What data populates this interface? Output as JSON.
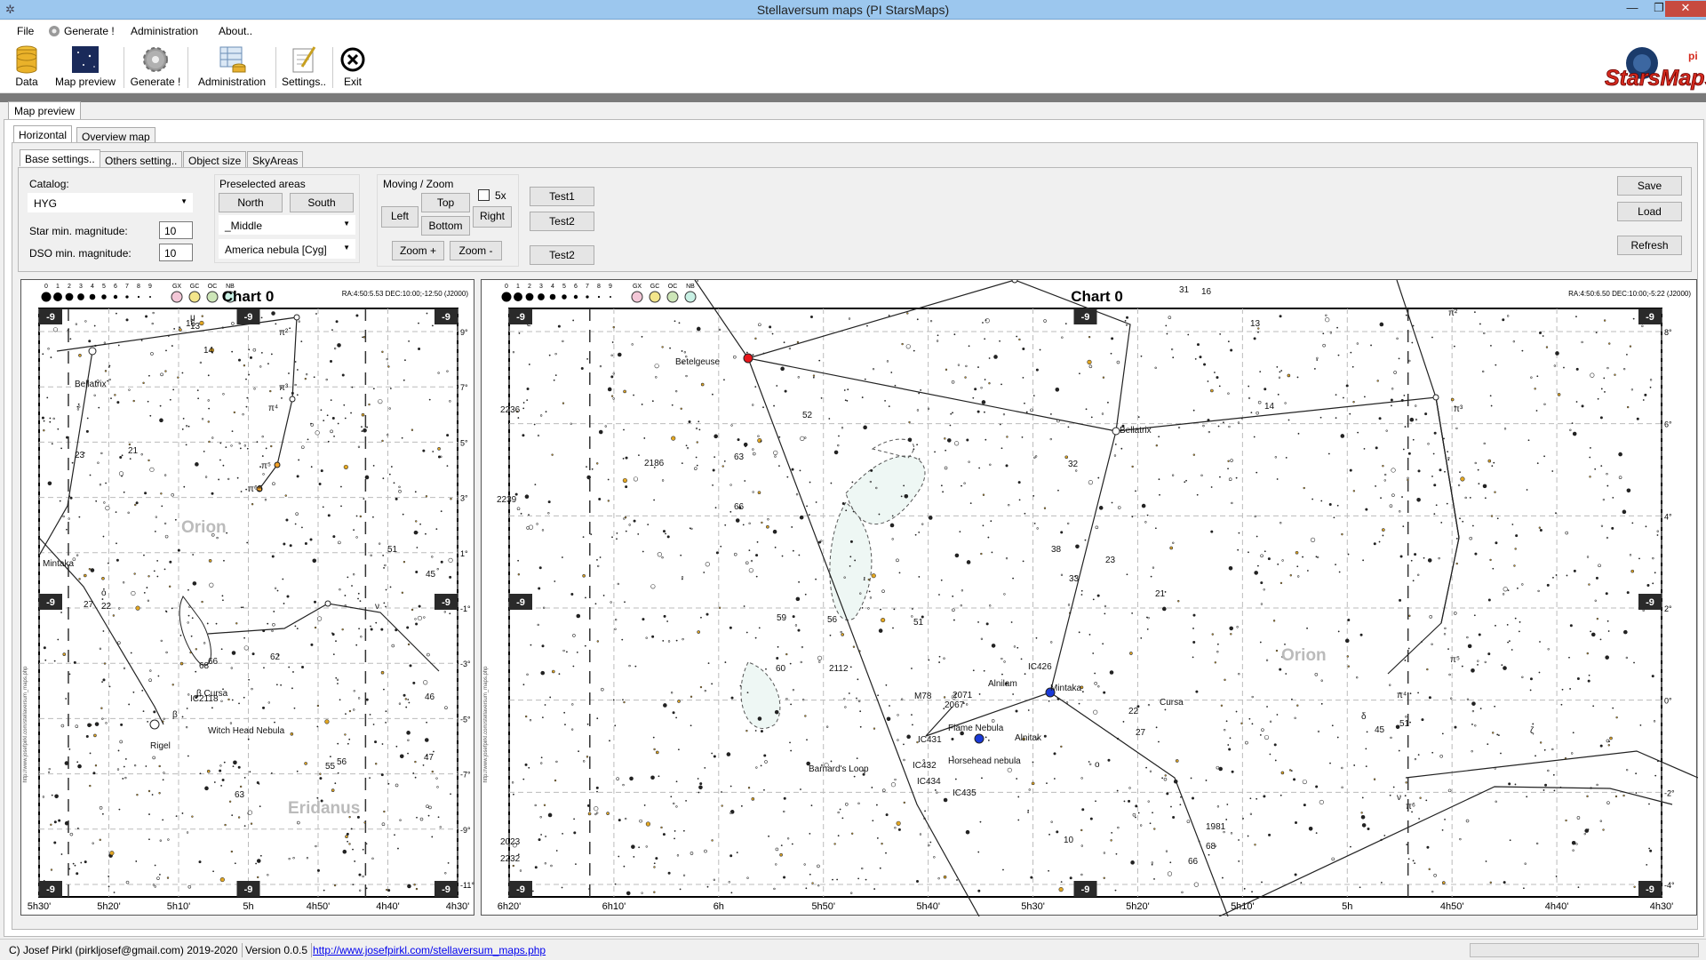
{
  "window": {
    "title": "Stellaversum maps (PI StarsMaps)",
    "min": "—",
    "max": "❐",
    "close": "✕"
  },
  "menu": [
    {
      "label": "File"
    },
    {
      "label": "Generate !"
    },
    {
      "label": "Administration"
    },
    {
      "label": "About.."
    }
  ],
  "toolbar": [
    {
      "label": "Data",
      "icon": "database-icon"
    },
    {
      "label": "Map preview",
      "icon": "map-preview-icon"
    },
    {
      "label": "Generate !",
      "icon": "gear-icon"
    },
    {
      "label": "Administration",
      "icon": "administration-icon"
    },
    {
      "label": "Settings..",
      "icon": "settings-icon"
    },
    {
      "label": "Exit",
      "icon": "exit-icon"
    }
  ],
  "logo": {
    "text": "StarsMaps",
    "superscript": "pi"
  },
  "outer_tab": "Map preview",
  "view_tabs": [
    {
      "label": "Horizontal",
      "active": true
    },
    {
      "label": "Overview map",
      "active": false
    }
  ],
  "settings_tabs": [
    {
      "label": "Base settings..",
      "active": true
    },
    {
      "label": "Others setting..",
      "active": false
    },
    {
      "label": "Object size",
      "active": false
    },
    {
      "label": "SkyAreas",
      "active": false
    }
  ],
  "settings": {
    "catalog_label": "Catalog:",
    "catalog_value": "HYG",
    "star_mag_label": "Star min. magnitude:",
    "star_mag_value": "10",
    "dso_mag_label": "DSO min. magnitude:",
    "dso_mag_value": "10",
    "preselected_title": "Preselected areas",
    "north": "North",
    "south": "South",
    "area_value": "_Middle",
    "object_value": "America nebula [Cyg]",
    "moving_title": "Moving / Zoom",
    "left": "Left",
    "top": "Top",
    "bottom": "Bottom",
    "right": "Right",
    "fivex": "5x",
    "zoom_in": "Zoom +",
    "zoom_out": "Zoom -",
    "test1": "Test1",
    "test2a": "Test2",
    "test2b": "Test2",
    "save": "Save",
    "load": "Load",
    "refresh": "Refresh"
  },
  "charts": [
    {
      "title": "Chart 0",
      "info": "RA:4:50:5.53  DEC:10:00;-12:50  (J2000)",
      "corner": "-9",
      "mag_scale": [
        "0",
        "1",
        "2",
        "3",
        "4",
        "5",
        "6",
        "7",
        "8",
        "9"
      ],
      "legend": [
        "GX",
        "GC",
        "OC",
        "NB"
      ],
      "ra_ticks": [
        "5h30'",
        "5h20'",
        "5h10'",
        "5h",
        "4h50'",
        "4h40'",
        "4h30'"
      ],
      "dec_ticks": [
        "9°",
        "7°",
        "5°",
        "3°",
        "1°",
        "-1°",
        "-3°",
        "-5°",
        "-7°",
        "-9°",
        "-11°"
      ],
      "constellations": [
        "Orion",
        "Eridanus"
      ],
      "labels": [
        "Bellatrix",
        "Mintaka",
        "Rigel",
        "β Cursa",
        "IC2118",
        "Witch Head Nebula",
        "16",
        "13",
        "14",
        "21",
        "23",
        "27",
        "22",
        "45",
        "51",
        "56",
        "55",
        "63",
        "66",
        "62",
        "46",
        "47",
        "68",
        "π²",
        "π³",
        "π⁴",
        "π⁵",
        "π⁶",
        "5",
        "ν",
        "ο",
        "μ",
        "β"
      ],
      "vertical_text": "http://www.josefpirkl.com/stellaversum_maps.php"
    },
    {
      "title": "Chart 0",
      "info": "RA:4:50:6.50  DEC:10:00;-5:22  (J2000)",
      "corner": "-9",
      "mag_scale": [
        "0",
        "1",
        "2",
        "3",
        "4",
        "5",
        "6",
        "7",
        "8",
        "9"
      ],
      "legend": [
        "GX",
        "GC",
        "OC",
        "NB"
      ],
      "ra_ticks": [
        "6h20'",
        "6h10'",
        "6h",
        "5h50'",
        "5h40'",
        "5h30'",
        "5h20'",
        "5h10'",
        "5h",
        "4h50'",
        "4h40'",
        "4h30'"
      ],
      "dec_ticks": [
        "8°",
        "6°",
        "4°",
        "2°",
        "0°",
        "-2°",
        "-4°"
      ],
      "constellations": [
        "Orion"
      ],
      "labels": [
        "Betelgeuse",
        "Bellatrix",
        "Alnilam",
        "Mintaka",
        "Alnitak",
        "Flame Nebula",
        "Horsehead nebula",
        "Barnard's Loop",
        "M78",
        "2236",
        "2239",
        "2186",
        "63",
        "66",
        "52",
        "32",
        "38",
        "33",
        "23",
        "21",
        "59",
        "56",
        "51",
        "60",
        "2112",
        "2071",
        "2067",
        "IC426",
        "IC431",
        "IC432",
        "IC434",
        "IC435",
        "2023",
        "2232",
        "10",
        "1981",
        "68",
        "66",
        "Cursa",
        "22",
        "27",
        "31",
        "16",
        "13",
        "14",
        "45",
        "51",
        "μ",
        "π²",
        "π³",
        "π⁴",
        "π⁵",
        "π⁶",
        "ν",
        "ο",
        "δ",
        "ζ",
        "ε"
      ],
      "vertical_text": "http://www.josefpirkl.com/stellaversum_maps.php"
    }
  ],
  "status": {
    "copyright": "C) Josef Pirkl (pirkljosef@gmail.com) 2019-2020",
    "version": "Version 0.0.5",
    "url": "http://www.josefpirkl.com/stellaversum_maps.php"
  }
}
